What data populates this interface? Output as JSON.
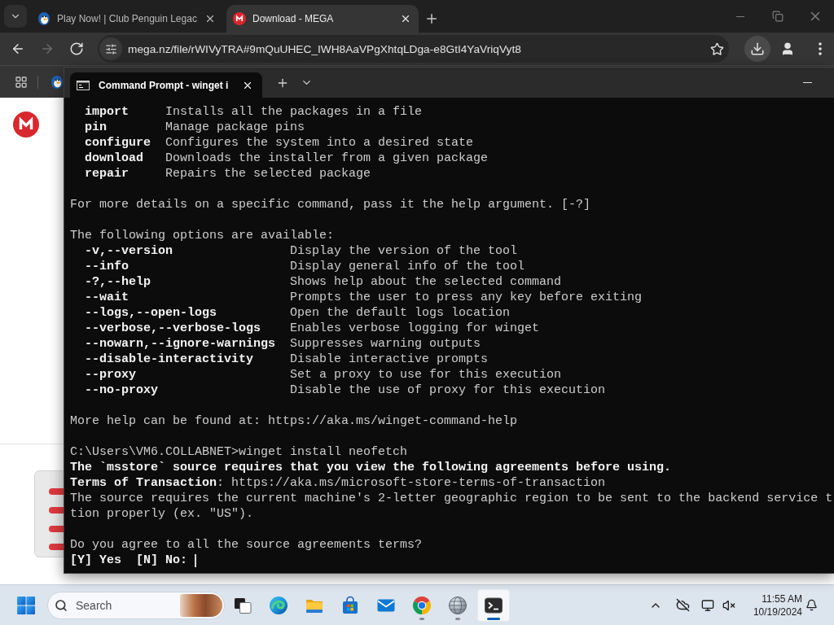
{
  "browser": {
    "tabs": [
      {
        "title": "Play Now! | Club Penguin Legac",
        "selected": false
      },
      {
        "title": "Download - MEGA",
        "selected": true
      }
    ],
    "nav_buttons": [
      {
        "kind": "back",
        "disabled": false
      },
      {
        "kind": "forward",
        "disabled": true
      },
      {
        "kind": "reload",
        "disabled": false
      }
    ],
    "address_bar": {
      "url": "mega.nz/file/rWIVyTRA#9mQuUHEC_IWH8AaVPgXhtqLDga-e8GtI4YaVriqVyt8"
    }
  },
  "terminal": {
    "tabs": [
      {
        "title": "Command Prompt - winget i",
        "selected": true
      }
    ],
    "lines": [
      {
        "kind": "command",
        "name": "import",
        "description": "Installs all the packages in a file"
      },
      {
        "kind": "command",
        "name": "pin",
        "description": "Manage package pins"
      },
      {
        "kind": "command",
        "name": "configure",
        "description": "Configures the system into a desired state"
      },
      {
        "kind": "command",
        "name": "download",
        "description": "Downloads the installer from a given package"
      },
      {
        "kind": "command",
        "name": "repair",
        "description": "Repairs the selected package"
      },
      {
        "kind": "blank"
      },
      {
        "kind": "text",
        "text": "For more details on a specific command, pass it the help argument. [-?]"
      },
      {
        "kind": "blank"
      },
      {
        "kind": "text",
        "text": "The following options are available:"
      },
      {
        "kind": "option",
        "name": "-v,--version",
        "description": "Display the version of the tool"
      },
      {
        "kind": "option",
        "name": "--info",
        "description": "Display general info of the tool"
      },
      {
        "kind": "option",
        "name": "-?,--help",
        "description": "Shows help about the selected command"
      },
      {
        "kind": "option",
        "name": "--wait",
        "description": "Prompts the user to press any key before exiting"
      },
      {
        "kind": "option",
        "name": "--logs,--open-logs",
        "description": "Open the default logs location"
      },
      {
        "kind": "option",
        "name": "--verbose,--verbose-logs",
        "description": "Enables verbose logging for winget"
      },
      {
        "kind": "option",
        "name": "--nowarn,--ignore-warnings",
        "description": "Suppresses warning outputs"
      },
      {
        "kind": "option",
        "name": "--disable-interactivity",
        "description": "Disable interactive prompts"
      },
      {
        "kind": "option",
        "name": "--proxy",
        "description": "Set a proxy to use for this execution"
      },
      {
        "kind": "option",
        "name": "--no-proxy",
        "description": "Disable the use of proxy for this execution"
      },
      {
        "kind": "blank"
      },
      {
        "kind": "text",
        "text": "More help can be found at: https://aka.ms/winget-command-help"
      },
      {
        "kind": "blank"
      },
      {
        "kind": "text",
        "text": "C:\\Users\\VM6.COLLABNET>winget install neofetch"
      },
      {
        "kind": "bright",
        "text": "The `msstore` source requires that you view the following agreements before using."
      },
      {
        "kind": "text",
        "text": "**Terms of Transaction**: https://aka.ms/microsoft-store-terms-of-transaction"
      },
      {
        "kind": "text",
        "text": "The source requires the current machine's 2-letter geographic region to be sent to the backend service t"
      },
      {
        "kind": "text",
        "text": "tion properly (ex. \"US\")."
      },
      {
        "kind": "blank"
      },
      {
        "kind": "text",
        "text": "Do you agree to all the source agreements terms?"
      },
      {
        "kind": "prompt",
        "text": "[Y] Yes  [N] No:",
        "cursor": true
      }
    ]
  },
  "taskbar": {
    "search": {
      "placeholder": "Search"
    },
    "apps": [
      {
        "kind": "taskview",
        "running": false,
        "active": false
      },
      {
        "kind": "swirl",
        "running": false,
        "active": false
      },
      {
        "kind": "folder",
        "running": false,
        "active": false
      },
      {
        "kind": "bag",
        "running": false,
        "active": false
      },
      {
        "kind": "envelope",
        "running": false,
        "active": false
      },
      {
        "kind": "ring",
        "running": true,
        "active": false
      },
      {
        "kind": "globe",
        "running": true,
        "active": false
      },
      {
        "kind": "console",
        "running": true,
        "active": true
      }
    ],
    "clock": {
      "time": "11:55 AM",
      "date": "10/19/2024"
    }
  }
}
